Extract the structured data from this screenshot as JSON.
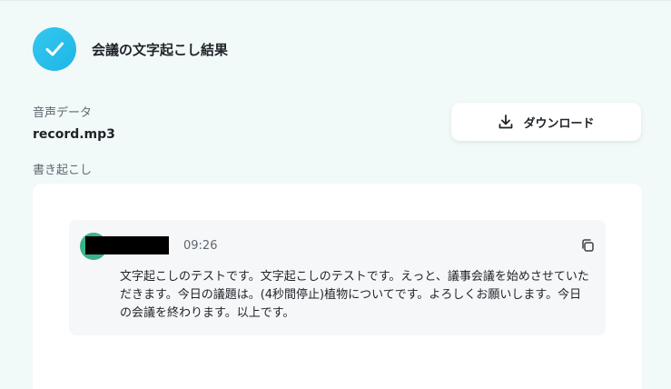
{
  "header": {
    "title": "会議の文字起こし結果",
    "icon": "check-icon",
    "accent": "#1db6e6"
  },
  "audio": {
    "label": "音声データ",
    "filename": "record.mp3"
  },
  "download": {
    "label": "ダウンロード",
    "icon": "download-icon"
  },
  "transcript": {
    "label": "書き起こし",
    "entries": [
      {
        "time": "09:26",
        "text": "文字起こしのテストです。文字起こしのテストです。えっと、議事会議を始めさせていただきます。今日の議題は。(4秒間停止)植物についてです。よろしくお願いします。今日の会議を終わります。以上です。",
        "avatar_color": "#3bb38a"
      }
    ]
  }
}
